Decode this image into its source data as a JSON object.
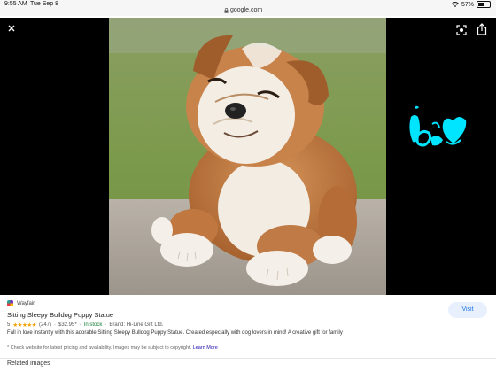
{
  "status_bar": {
    "time": "9:55 AM",
    "date": "Tue Sep 8",
    "url": "google.com",
    "battery": "57%"
  },
  "viewer": {
    "close_icon": "close-icon",
    "lens_icon": "lens-icon",
    "share_icon": "share-icon"
  },
  "result": {
    "source": "Wayfair",
    "title": "Sitting Sleepy Bulldog Puppy Statue",
    "rating": "5",
    "stars": "★★★★★",
    "reviews": "(247)",
    "price": "$32.95*",
    "stock": "In stock",
    "brand": "Brand: Hi-Line Gift Ltd.",
    "description": "Fall in love instantly with this adorable Sitting Sleepy Bulldog Puppy Statue. Created especially with dog lovers in mind! A creative gift for family",
    "disclaimer": "* Check website for latest pricing and availability. Images may be subject to copyright.",
    "learn_more": "Learn More",
    "visit_label": "Visit"
  },
  "related_label": "Related images",
  "colors": {
    "accent": "#1a73e8",
    "visit_bg": "#e8f0fe",
    "stars": "#f4a300",
    "stock": "#188038",
    "doodle": "#00e5ff"
  }
}
